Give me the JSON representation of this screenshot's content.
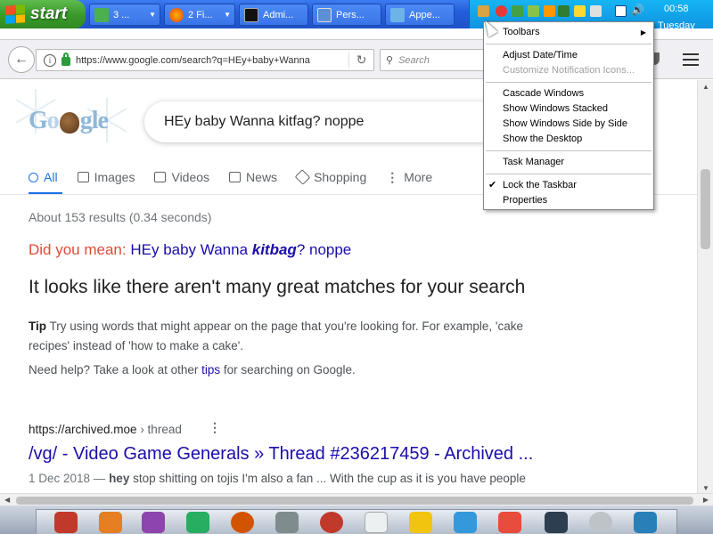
{
  "taskbar": {
    "start_label": "start",
    "tasks": [
      {
        "label": "3 ...",
        "icon": "people-icon"
      },
      {
        "label": "2 Fi...",
        "icon": "firefox-icon"
      },
      {
        "label": "Admi...",
        "icon": "cmd-icon"
      },
      {
        "label": "Pers...",
        "icon": "display-icon"
      },
      {
        "label": "Appe...",
        "icon": "appearance-icon"
      }
    ],
    "clock_time": "00:58",
    "clock_day": "Tuesday"
  },
  "context_menu": {
    "items": [
      {
        "label": "Toolbars",
        "has_submenu": true
      },
      {
        "label": "Adjust Date/Time"
      },
      {
        "label": "Customize Notification Icons...",
        "disabled": true
      },
      {
        "label": "Cascade Windows"
      },
      {
        "label": "Show Windows Stacked"
      },
      {
        "label": "Show Windows Side by Side"
      },
      {
        "label": "Show the Desktop"
      },
      {
        "label": "Task Manager"
      },
      {
        "label": "Lock the Taskbar",
        "checked": true
      },
      {
        "label": "Properties"
      }
    ]
  },
  "browser": {
    "url": "https://www.google.com/search?q=HEy+baby+Wanna",
    "search_placeholder": "Search"
  },
  "page": {
    "query": "HEy baby Wanna kitfag? noppe",
    "tabs": [
      "All",
      "Images",
      "Videos",
      "News",
      "Shopping",
      "More"
    ],
    "stats": "About 153 results (0.34 seconds)",
    "did_you_mean_label": "Did you mean:",
    "did_you_mean_pre": "HEy baby Wanna ",
    "did_you_mean_bold": "kitbag",
    "did_you_mean_post": "? noppe",
    "headline": "It looks like there aren't many great matches for your search",
    "tip_label": "Tip",
    "tip_text": "Try using words that might appear on the page that you're looking for. For example, 'cake recipes' instead of 'how to make a cake'.",
    "help_pre": "Need help? Take a look at other ",
    "help_link": "tips",
    "help_post": " for searching on Google.",
    "result": {
      "url": "https://archived.moe",
      "crumb": " › thread",
      "title": "/vg/ - Video Game Generals » Thread #236217459 - Archived ...",
      "date": "1 Dec 2018 — ",
      "snippet_bold": "hey",
      "snippet": " stop shitting on tojis I'm also a fan ... With the cup as it is you have people"
    }
  }
}
